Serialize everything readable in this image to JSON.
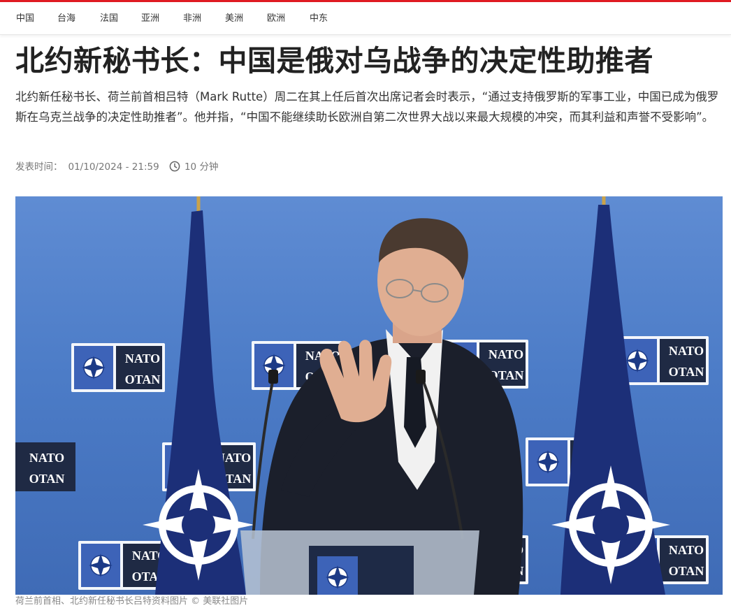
{
  "nav": {
    "items": [
      {
        "label": "中国"
      },
      {
        "label": "台海"
      },
      {
        "label": "法国"
      },
      {
        "label": "亚洲"
      },
      {
        "label": "非洲"
      },
      {
        "label": "美洲"
      },
      {
        "label": "欧洲"
      },
      {
        "label": "中东"
      }
    ]
  },
  "article": {
    "headline": "北约新秘书长：中国是俄对乌战争的决定性助推者",
    "lede": "北约新任秘书长、荷兰前首相吕特（Mark Rutte）周二在其上任后首次出席记者会时表示，“通过支持俄罗斯的军事工业，中国已成为俄罗斯在乌克兰战争的决定性助推者”。他并指，“中国不能继续助长欧洲自第二次世界大战以来最大规模的冲突，而其利益和声誉不受影响”。",
    "published_label": "发表时间：",
    "published_at": "01/10/2024 - 21:59",
    "read_time": "10 分钟",
    "photo": {
      "sign_line1": "NATO",
      "sign_line2": "OTAN",
      "caption": "荷兰前首相、北约新任秘书长吕特资料图片 © 美联社图片"
    }
  },
  "colors": {
    "accent": "#e01b22",
    "photo_backdrop": "#4c7cc7",
    "flag": "#1c2f78"
  },
  "icons": {
    "clock": "clock-icon",
    "nato_emblem": "nato-compass-icon"
  }
}
